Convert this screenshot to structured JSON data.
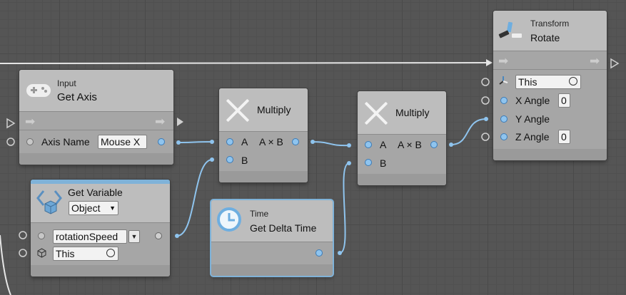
{
  "nodes": {
    "get_axis": {
      "category": "Input",
      "title": "Get Axis",
      "axis_name_label": "Axis Name",
      "axis_name_value": "Mouse X"
    },
    "get_variable": {
      "title": "Get Variable",
      "kind": "Object",
      "variable_name": "rotationSpeed",
      "target": "This"
    },
    "multiply_1": {
      "title": "Multiply",
      "input_a": "A",
      "input_b": "B",
      "output": "A × B"
    },
    "multiply_2": {
      "title": "Multiply",
      "input_a": "A",
      "input_b": "B",
      "output": "A × B"
    },
    "time": {
      "category": "Time",
      "title": "Get Delta Time"
    },
    "rotate": {
      "category": "Transform",
      "title": "Rotate",
      "target": "This",
      "x_label": "X Angle",
      "x_value": "0",
      "y_label": "Y Angle",
      "z_label": "Z Angle",
      "z_value": "0"
    }
  },
  "icons": {
    "get_axis": "gamepad-icon",
    "get_variable": "variable-icon",
    "multiply": "multiply-icon",
    "time": "clock-icon",
    "rotate": "transform-axes-icon"
  },
  "colors": {
    "port_blue": "#8fc4ee",
    "wire": "#8fc4ee",
    "flow": "#e0e0e0",
    "variable_accent": "#7fb2d8"
  }
}
